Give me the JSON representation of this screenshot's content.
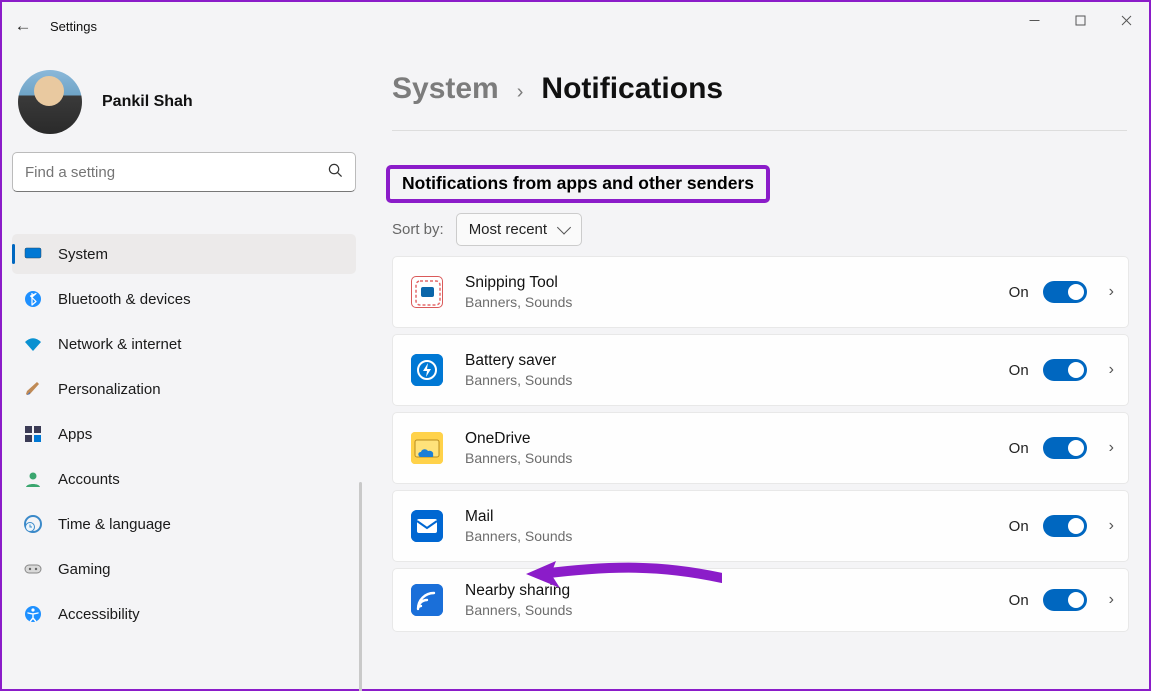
{
  "window": {
    "title": "Settings"
  },
  "profile": {
    "name": "Pankil Shah"
  },
  "search": {
    "placeholder": "Find a setting"
  },
  "sidebar": {
    "items": [
      {
        "label": "System"
      },
      {
        "label": "Bluetooth & devices"
      },
      {
        "label": "Network & internet"
      },
      {
        "label": "Personalization"
      },
      {
        "label": "Apps"
      },
      {
        "label": "Accounts"
      },
      {
        "label": "Time & language"
      },
      {
        "label": "Gaming"
      },
      {
        "label": "Accessibility"
      }
    ],
    "selected_index": 0
  },
  "breadcrumb": {
    "parent": "System",
    "current": "Notifications"
  },
  "section": {
    "header": "Notifications from apps and other senders",
    "sort_label": "Sort by:",
    "sort_value": "Most recent"
  },
  "apps": [
    {
      "name": "Snipping Tool",
      "sub": "Banners, Sounds",
      "state": "On",
      "toggle": true
    },
    {
      "name": "Battery saver",
      "sub": "Banners, Sounds",
      "state": "On",
      "toggle": true
    },
    {
      "name": "OneDrive",
      "sub": "Banners, Sounds",
      "state": "On",
      "toggle": true
    },
    {
      "name": "Mail",
      "sub": "Banners, Sounds",
      "state": "On",
      "toggle": true
    },
    {
      "name": "Nearby sharing",
      "sub": "Banners, Sounds",
      "state": "On",
      "toggle": true
    }
  ],
  "annotation": {
    "highlight_target": "section_header",
    "arrow_target": "Mail"
  }
}
